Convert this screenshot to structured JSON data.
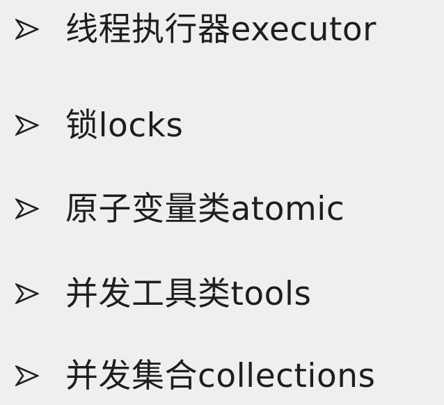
{
  "items": [
    {
      "text": "线程执行器executor"
    },
    {
      "text": "锁locks"
    },
    {
      "text": "原子变量类atomic"
    },
    {
      "text": "并发工具类tools"
    },
    {
      "text": "并发集合collections"
    }
  ],
  "icon": "arrowhead-bullet-icon",
  "colors": {
    "background": "#efefef",
    "text": "#1e1e1e"
  }
}
